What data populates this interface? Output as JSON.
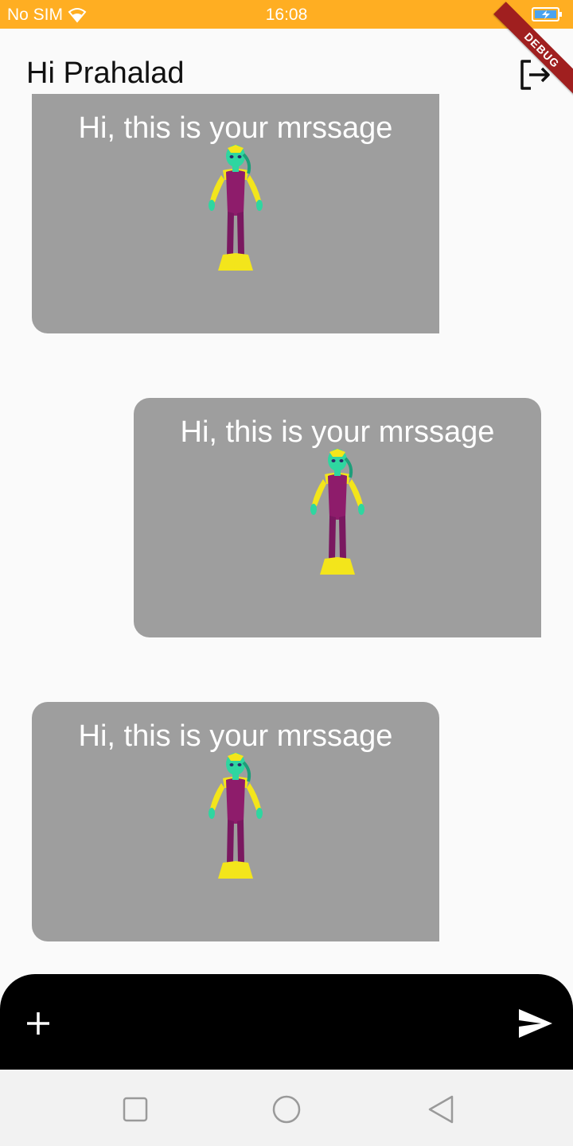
{
  "status_bar": {
    "carrier": "No SIM",
    "time": "16:08",
    "icons": [
      "wifi-icon",
      "battery-charging-icon"
    ],
    "color": "#FFAE22"
  },
  "app_bar": {
    "title": "Hi Prahalad",
    "logout_icon": "logout-icon"
  },
  "debug_banner": {
    "label": "DEBUG"
  },
  "messages": [
    {
      "text": "Hi, this is your mrssage",
      "image": "character-figure",
      "align": "left"
    },
    {
      "text": "Hi, this is your mrssage",
      "image": "character-figure",
      "align": "right"
    },
    {
      "text": "Hi, this is your mrssage",
      "image": "character-figure",
      "align": "left"
    }
  ],
  "composer": {
    "add_icon": "plus-icon",
    "send_icon": "send-icon"
  },
  "nav_bar": {
    "buttons": [
      "recent-apps-icon",
      "home-icon",
      "back-icon"
    ]
  },
  "colors": {
    "message_bg": "#9E9E9E",
    "composer_bg": "#000000",
    "debug_banner": "#A01F1F"
  }
}
